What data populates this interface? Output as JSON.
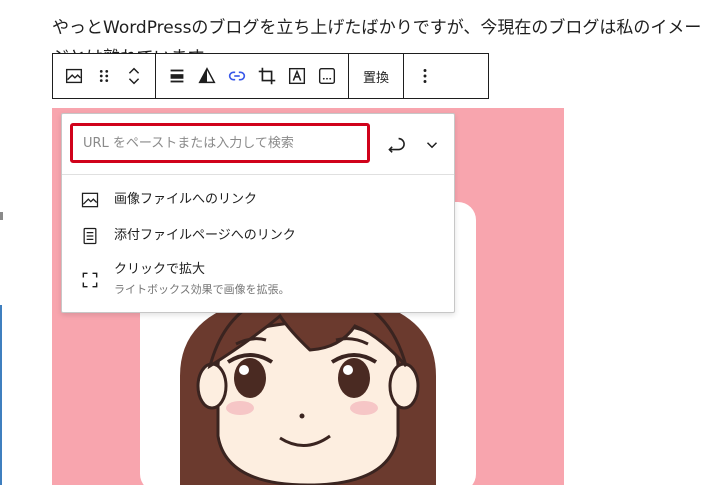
{
  "paragraph": {
    "line1": "やっとWordPressのブログを立ち上げたばかりですが、今現在のブログは私のイメー",
    "line2": "ジとは離れています。"
  },
  "toolbar": {
    "replace_label": "置換"
  },
  "link_popover": {
    "placeholder": "URL をペーストまたは入力して検索",
    "options": [
      {
        "label": "画像ファイルへのリンク",
        "icon": "image-icon"
      },
      {
        "label": "添付ファイルページへのリンク",
        "icon": "page-icon"
      },
      {
        "label": "クリックで拡大",
        "description": "ライトボックス効果で画像を拡張。",
        "icon": "fullscreen-icon"
      }
    ]
  },
  "colors": {
    "image_background": "#f8a5ae",
    "input_highlight": "#d0021b",
    "active_icon": "#3858e9"
  }
}
